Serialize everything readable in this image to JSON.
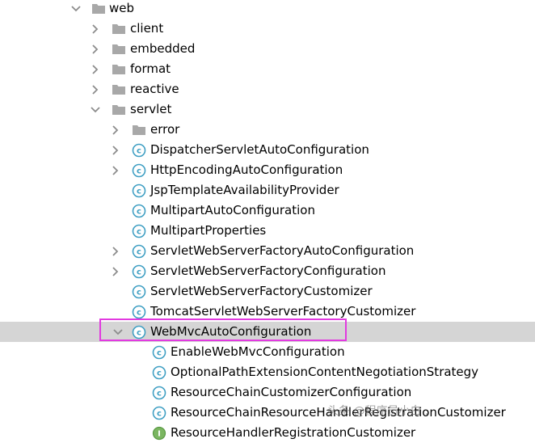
{
  "tree": {
    "web": "web",
    "client": "client",
    "embedded": "embedded",
    "format": "format",
    "reactive": "reactive",
    "servlet": "servlet",
    "error": "error",
    "dispatcher": "DispatcherServletAutoConfiguration",
    "http_encoding": "HttpEncodingAutoConfiguration",
    "jsp_template": "JspTemplateAvailabilityProvider",
    "multipart_auto": "MultipartAutoConfiguration",
    "multipart_props": "MultipartProperties",
    "servlet_factory_auto": "ServletWebServerFactoryAutoConfiguration",
    "servlet_factory_config": "ServletWebServerFactoryConfiguration",
    "servlet_factory_customizer": "ServletWebServerFactoryCustomizer",
    "tomcat_customizer": "TomcatServletWebServerFactoryCustomizer",
    "webmvc_auto": "WebMvcAutoConfiguration",
    "enable_webmvc": "EnableWebMvcConfiguration",
    "optional_path": "OptionalPathExtensionContentNegotiationStrategy",
    "resource_chain_customizer": "ResourceChainCustomizerConfiguration",
    "resource_chain_handler": "ResourceChainResourceHandlerRegistrationCustomizer",
    "resource_handler_partial": "ResourceHandlerRegistrationCustomizer"
  },
  "watermark": "头条 @程序员小白 .",
  "colors": {
    "selection": "#d5d5d5",
    "highlight_border": "#e23ae0",
    "folder": "#a8a8a8",
    "class_icon": "#3f9fc3",
    "chevron": "#8c8c8c"
  }
}
